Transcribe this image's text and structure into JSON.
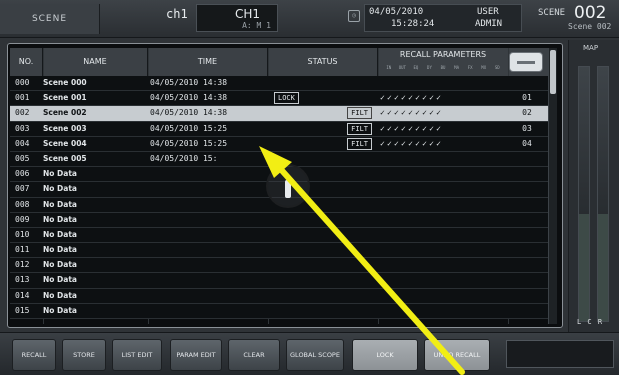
{
  "header": {
    "scene_label": "SCENE",
    "channel_id": "ch1",
    "channel_name": "CH1",
    "channel_sub": "A: M 1",
    "date": "04/05/2010",
    "time": "15:28:24",
    "user_label": "USER",
    "user_name": "ADMIN",
    "scene_word": "SCENE",
    "scene_number": "002",
    "scene_name": "Scene 002"
  },
  "table": {
    "columns": {
      "no": "NO.",
      "name": "NAME",
      "time": "TIME",
      "status": "STATUS",
      "recall": "RECALL PARAMETERS"
    },
    "rows": [
      {
        "no": "000",
        "name": "Scene 000",
        "time": "04/05/2010 14:38",
        "status_left": "",
        "status_right": "",
        "rp": "",
        "rpn": ""
      },
      {
        "no": "001",
        "name": "Scene 001",
        "time": "04/05/2010 14:38",
        "status_left": "LOCK",
        "status_right": "",
        "rp": "✓✓✓✓✓✓✓✓✓",
        "rpn": "01"
      },
      {
        "no": "002",
        "name": "Scene 002",
        "time": "04/05/2010 14:38",
        "status_left": "",
        "status_right": "FILT",
        "rp": "✓✓✓✓✓✓✓✓✓",
        "rpn": "02"
      },
      {
        "no": "003",
        "name": "Scene 003",
        "time": "04/05/2010 15:25",
        "status_left": "",
        "status_right": "FILT",
        "rp": "✓✓✓✓✓✓✓✓✓",
        "rpn": "03"
      },
      {
        "no": "004",
        "name": "Scene 004",
        "time": "04/05/2010 15:25",
        "status_left": "",
        "status_right": "FILT",
        "rp": "✓✓✓✓✓✓✓✓✓",
        "rpn": "04"
      },
      {
        "no": "005",
        "name": "Scene 005",
        "time": "04/05/2010 15:",
        "status_left": "",
        "status_right": "",
        "rp": "",
        "rpn": ""
      },
      {
        "no": "006",
        "name": "No Data",
        "time": "",
        "status_left": "",
        "status_right": "",
        "rp": "",
        "rpn": ""
      },
      {
        "no": "007",
        "name": "No Data",
        "time": "",
        "status_left": "",
        "status_right": "",
        "rp": "",
        "rpn": ""
      },
      {
        "no": "008",
        "name": "No Data",
        "time": "",
        "status_left": "",
        "status_right": "",
        "rp": "",
        "rpn": ""
      },
      {
        "no": "009",
        "name": "No Data",
        "time": "",
        "status_left": "",
        "status_right": "",
        "rp": "",
        "rpn": ""
      },
      {
        "no": "010",
        "name": "No Data",
        "time": "",
        "status_left": "",
        "status_right": "",
        "rp": "",
        "rpn": ""
      },
      {
        "no": "011",
        "name": "No Data",
        "time": "",
        "status_left": "",
        "status_right": "",
        "rp": "",
        "rpn": ""
      },
      {
        "no": "012",
        "name": "No Data",
        "time": "",
        "status_left": "",
        "status_right": "",
        "rp": "",
        "rpn": ""
      },
      {
        "no": "013",
        "name": "No Data",
        "time": "",
        "status_left": "",
        "status_right": "",
        "rp": "",
        "rpn": ""
      },
      {
        "no": "014",
        "name": "No Data",
        "time": "",
        "status_left": "",
        "status_right": "",
        "rp": "",
        "rpn": ""
      },
      {
        "no": "015",
        "name": "No Data",
        "time": "",
        "status_left": "",
        "status_right": "",
        "rp": "",
        "rpn": ""
      }
    ],
    "selected_index": 2
  },
  "meter": {
    "title": "MAP",
    "label": "L C R"
  },
  "buttons": [
    {
      "id": "recall",
      "label": "RECALL"
    },
    {
      "id": "store",
      "label": "STORE"
    },
    {
      "id": "list-edit",
      "label": "LIST EDIT"
    },
    {
      "id": "param-edit",
      "label": "PARAM EDIT"
    },
    {
      "id": "clear",
      "label": "CLEAR"
    },
    {
      "id": "global-scope",
      "label": "GLOBAL SCOPE"
    },
    {
      "id": "lock",
      "label": "LOCK"
    },
    {
      "id": "undo-recall",
      "label": "UNDO RECALL"
    }
  ],
  "colors": {
    "background": "#2f3337",
    "table_bg": "#0b0d0f",
    "selected_row": "#c7ccd0",
    "annotation_arrow": "#f2ee14"
  }
}
